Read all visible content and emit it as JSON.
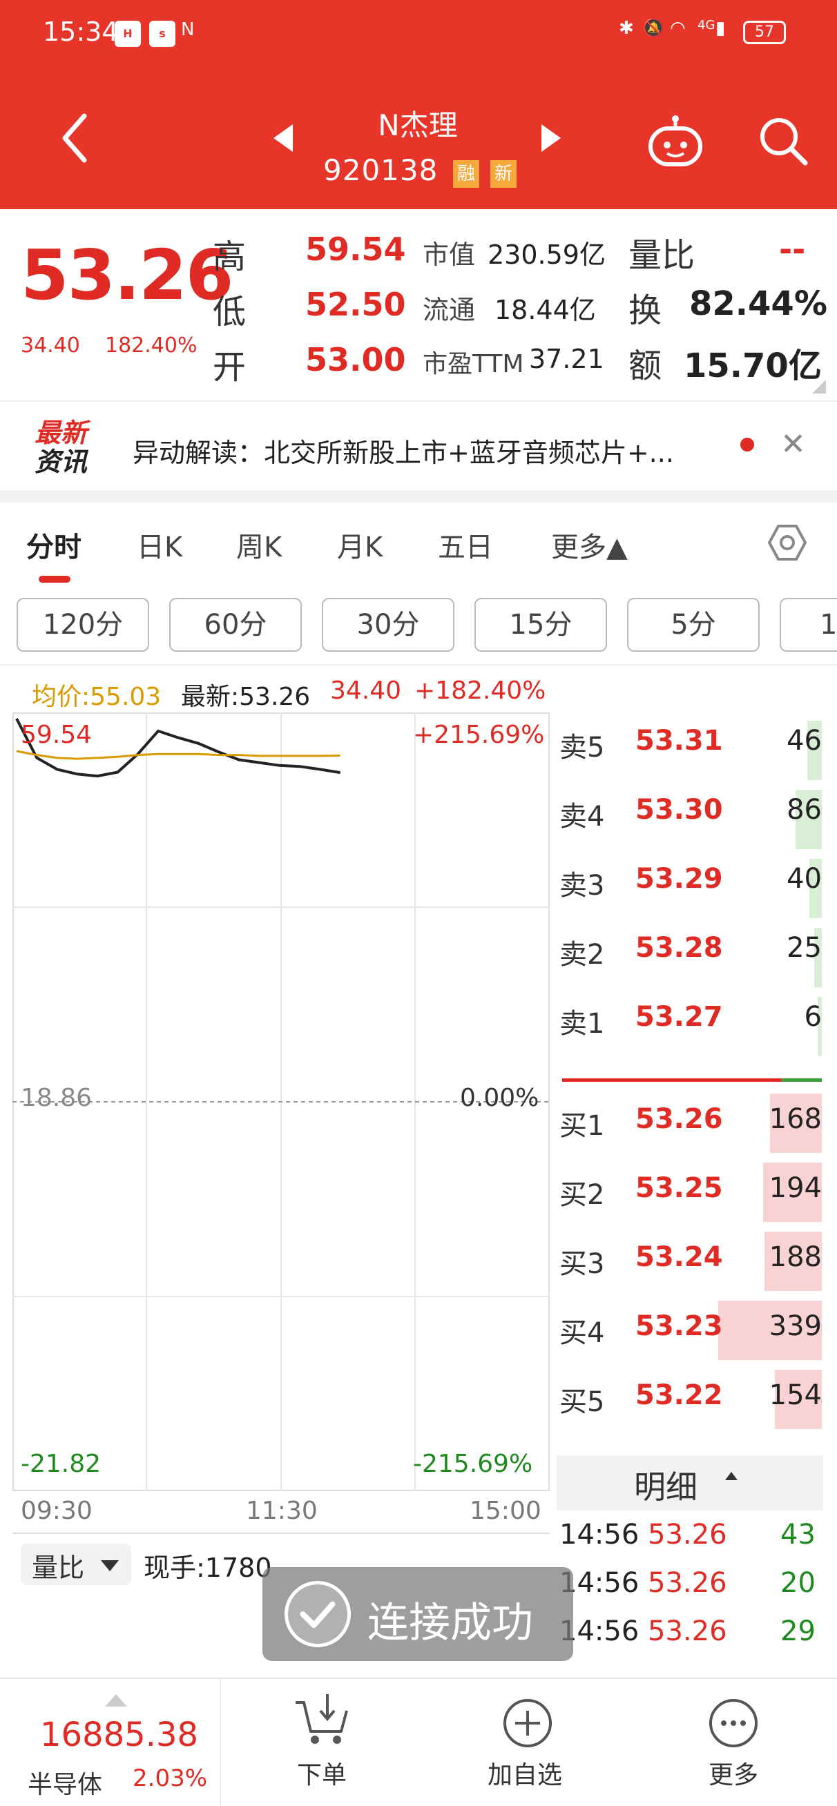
{
  "status_bar": {
    "time": "15:34",
    "battery": "57",
    "network": "4G"
  },
  "header": {
    "stock_name": "N杰理",
    "stock_code": "920138",
    "tags": [
      "融",
      "新"
    ]
  },
  "quote": {
    "price": "53.26",
    "change": "34.40",
    "change_pct": "182.40%",
    "high_label": "高",
    "high": "59.54",
    "low_label": "低",
    "low": "52.50",
    "open_label": "开",
    "open": "53.00",
    "mcap_label": "市值",
    "mcap": "230.59亿",
    "float_label": "流通",
    "float": "18.44亿",
    "pe_label": "市盈TTM",
    "pe": "37.21",
    "vr_label": "量比",
    "vr": "--",
    "turn_label": "换",
    "turn": "82.44%",
    "amt_label": "额",
    "amt": "15.70亿"
  },
  "news": {
    "logo_line1": "最新",
    "logo_line2": "资讯",
    "text": "异动解读：北交所新股上市+蓝牙音频芯片+..."
  },
  "tabs": [
    "分时",
    "日K",
    "周K",
    "月K",
    "五日",
    "更多▲"
  ],
  "intervals": [
    "120分",
    "60分",
    "30分",
    "15分",
    "5分",
    "1"
  ],
  "chart_header": {
    "avg": "均价:55.03",
    "latest": "最新:53.26",
    "change": "34.40",
    "change_pct": "+182.40%"
  },
  "chart_labels": {
    "top_price": "59.54",
    "top_pct": "+215.69%",
    "mid_price": "18.86",
    "mid_pct": "0.00%",
    "bot_price": "-21.82",
    "bot_pct": "-215.69%",
    "t_start": "09:30",
    "t_mid": "11:30",
    "t_end": "15:00"
  },
  "chart_data": {
    "type": "line",
    "x": [
      "09:30",
      "09:45",
      "10:00",
      "10:15",
      "10:30",
      "10:45",
      "11:00",
      "11:15",
      "11:30",
      "13:15",
      "13:30",
      "13:45",
      "14:00",
      "14:15",
      "14:30",
      "14:45",
      "15:00"
    ],
    "series": [
      {
        "name": "",
        "values": [
          58.9,
          54.8,
          53.6,
          53.1,
          52.9,
          53.3,
          55.2,
          57.6,
          56.9,
          56.3,
          55.4,
          54.6,
          54.3,
          54.0,
          53.9,
          53.6,
          53.26
        ]
      },
      {
        "name": "均价",
        "values": [
          55.5,
          55.1,
          54.8,
          54.7,
          54.8,
          54.9,
          55.1,
          55.2,
          55.2,
          55.2,
          55.1,
          55.1,
          55.0,
          55.0,
          55.0,
          55.0,
          55.03
        ]
      }
    ],
    "ylim": [
      -21.82,
      59.54
    ],
    "colors": [
      "#222222",
      "#d99a00"
    ]
  },
  "order_book": {
    "asks": [
      {
        "label": "卖5",
        "price": "53.31",
        "vol": "46",
        "level": 0.14
      },
      {
        "label": "卖4",
        "price": "53.30",
        "vol": "86",
        "level": 0.25
      },
      {
        "label": "卖3",
        "price": "53.29",
        "vol": "40",
        "level": 0.12
      },
      {
        "label": "卖2",
        "price": "53.28",
        "vol": "25",
        "level": 0.07
      },
      {
        "label": "卖1",
        "price": "53.27",
        "vol": "6",
        "level": 0.02
      }
    ],
    "bids": [
      {
        "label": "买1",
        "price": "53.26",
        "vol": "168",
        "level": 0.5
      },
      {
        "label": "买2",
        "price": "53.25",
        "vol": "194",
        "level": 0.57
      },
      {
        "label": "买3",
        "price": "53.24",
        "vol": "188",
        "level": 0.55
      },
      {
        "label": "买4",
        "price": "53.23",
        "vol": "339",
        "level": 1.0
      },
      {
        "label": "买5",
        "price": "53.22",
        "vol": "154",
        "level": 0.45
      }
    ]
  },
  "detail": {
    "title": "明细",
    "rows": [
      {
        "time": "14:56",
        "price": "53.26",
        "vol": "43"
      },
      {
        "time": "14:56",
        "price": "53.26",
        "vol": "20"
      },
      {
        "time": "14:56",
        "price": "53.26",
        "vol": "29"
      }
    ]
  },
  "volume": {
    "selector": "量比",
    "current": "现手:1780"
  },
  "toast": "连接成功",
  "bottom": {
    "index_value": "16885.38",
    "index_name": "半导体",
    "index_chg": "2.03%",
    "order": "下单",
    "add_watch": "加自选",
    "more": "更多"
  }
}
